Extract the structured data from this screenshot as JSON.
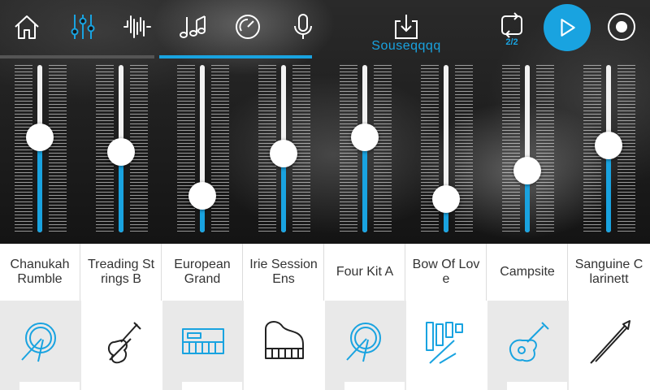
{
  "colors": {
    "accent": "#19a3e0",
    "dark_tab": "#555555"
  },
  "toolbar": {
    "buttons": [
      {
        "icon": "home-icon"
      },
      {
        "icon": "mixer-sliders-icon"
      },
      {
        "icon": "waveform-icon"
      },
      {
        "icon": "music-notes-icon"
      },
      {
        "icon": "dial-icon"
      },
      {
        "icon": "microphone-icon"
      }
    ],
    "active_tab": "mixer",
    "song_name": "Souseqqqq",
    "loop_counter": "2/2",
    "play_icon": "play-icon",
    "record_icon": "record-icon"
  },
  "channels": [
    {
      "name": "Chanukah Rumble",
      "level": 0.57,
      "icon": "drum-icon",
      "highlight": false
    },
    {
      "name": "Treading Strings B",
      "level": 0.48,
      "icon": "violin-icon",
      "highlight": true
    },
    {
      "name": "European Grand",
      "level": 0.22,
      "icon": "keyboard-icon",
      "highlight": false
    },
    {
      "name": "Irie Session Ens",
      "level": 0.47,
      "icon": "piano-icon",
      "highlight": true
    },
    {
      "name": "Four Kit A",
      "level": 0.57,
      "icon": "drum-icon",
      "highlight": false
    },
    {
      "name": "Bow Of Love",
      "level": 0.2,
      "icon": "xylophone-icon",
      "highlight": true
    },
    {
      "name": "Campsite",
      "level": 0.37,
      "icon": "guitar-icon",
      "highlight": false
    },
    {
      "name": "Sanguine Clarinett",
      "level": 0.52,
      "icon": "clarinet-icon",
      "highlight": true
    }
  ]
}
